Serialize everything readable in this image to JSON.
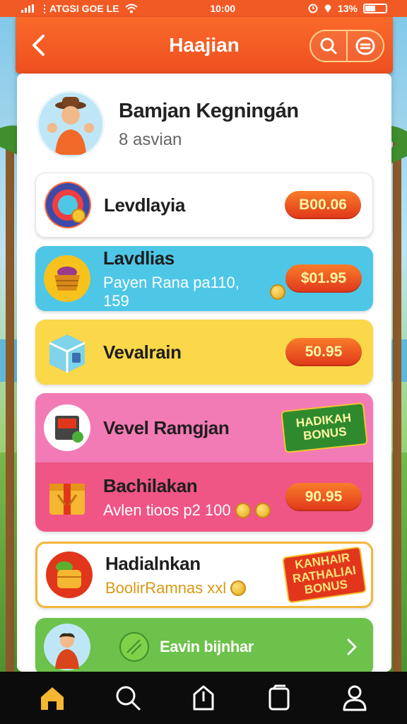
{
  "status_bar": {
    "carrier": "⋮ATGSI GOE LE",
    "time": "10:00",
    "battery": "13%"
  },
  "header": {
    "title": "Haajian",
    "back_icon": "chevron-left-icon",
    "actions": [
      "search-icon",
      "menu-icon"
    ]
  },
  "profile": {
    "name": "Bamjan Kegningán",
    "subtitle": "8 asvian"
  },
  "cards": [
    {
      "title": "Levdlayia",
      "price": "B00.06",
      "icon": "coin-bag-icon"
    },
    {
      "title": "Lavdlias",
      "subtitle": "Payen Rana pa110, 159",
      "price": "$01.95",
      "icon": "basket-icon"
    },
    {
      "title": "Vevalrain",
      "price": "50.95",
      "icon": "box-icon"
    },
    {
      "title": "Vevel Ramgjan",
      "badge_line1": "HADIKAH",
      "badge_line2": "BONUS",
      "icon": "book-icon"
    },
    {
      "title": "Bachilakan",
      "subtitle": "Avlen tioos p2 100",
      "price": "90.95",
      "icon": "gift-box-icon"
    },
    {
      "title": "Hadialnkan",
      "subtitle": "BoolirRamnas xxl",
      "badge_line1": "KANHAIR",
      "badge_line2": "RATHALIAI",
      "badge_line3": "BONUS",
      "icon": "treasure-icon"
    },
    {
      "title": "Eavin bijnhar",
      "icon": "coconut-icon"
    }
  ],
  "bottom_nav": [
    "home-icon",
    "search-icon",
    "share-icon",
    "wallet-icon",
    "profile-icon"
  ],
  "colors": {
    "brand": "#f15a24",
    "price_pill": "#e0361a",
    "blue_card": "#4ec7e7",
    "yellow_card": "#fbd74a",
    "pink_card": "#f27bb5",
    "pink_dark_card": "#ef5585",
    "green_card": "#6cc24a"
  }
}
